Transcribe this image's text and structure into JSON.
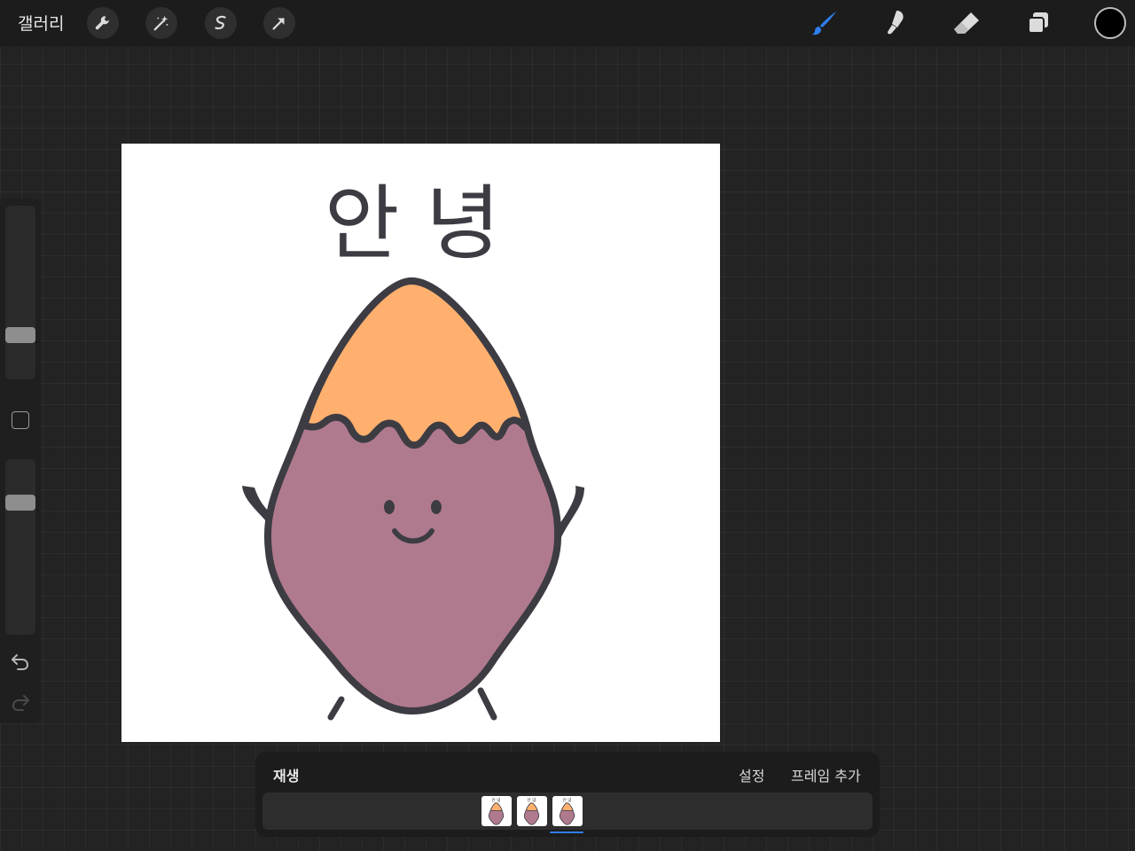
{
  "toolbar": {
    "gallery_label": "갤러리",
    "left_tools": [
      "wrench-icon",
      "magic-wand-icon",
      "selection-icon",
      "transform-arrow-icon"
    ],
    "right_tools": [
      "brush-icon",
      "smudge-icon",
      "eraser-icon",
      "layers-icon"
    ],
    "active_tool": "brush-icon",
    "accent_color": "#2f7ef0",
    "current_color": "#000000"
  },
  "sidebar": {
    "brush_size_level": 0.23,
    "opacity_level": 0.78,
    "buttons": [
      "modify-square",
      "undo-icon",
      "redo-icon"
    ]
  },
  "canvas": {
    "text": "안 녕",
    "colors": {
      "outline": "#3d3c43",
      "flesh": "#ffb06e",
      "skin": "#b07a8e",
      "background": "#ffffff"
    }
  },
  "animation": {
    "play_label": "재생",
    "settings_label": "설정",
    "add_frame_label": "프레임 추가",
    "frames": [
      "frame-1",
      "frame-2",
      "frame-3"
    ],
    "selected_frame": 3
  }
}
